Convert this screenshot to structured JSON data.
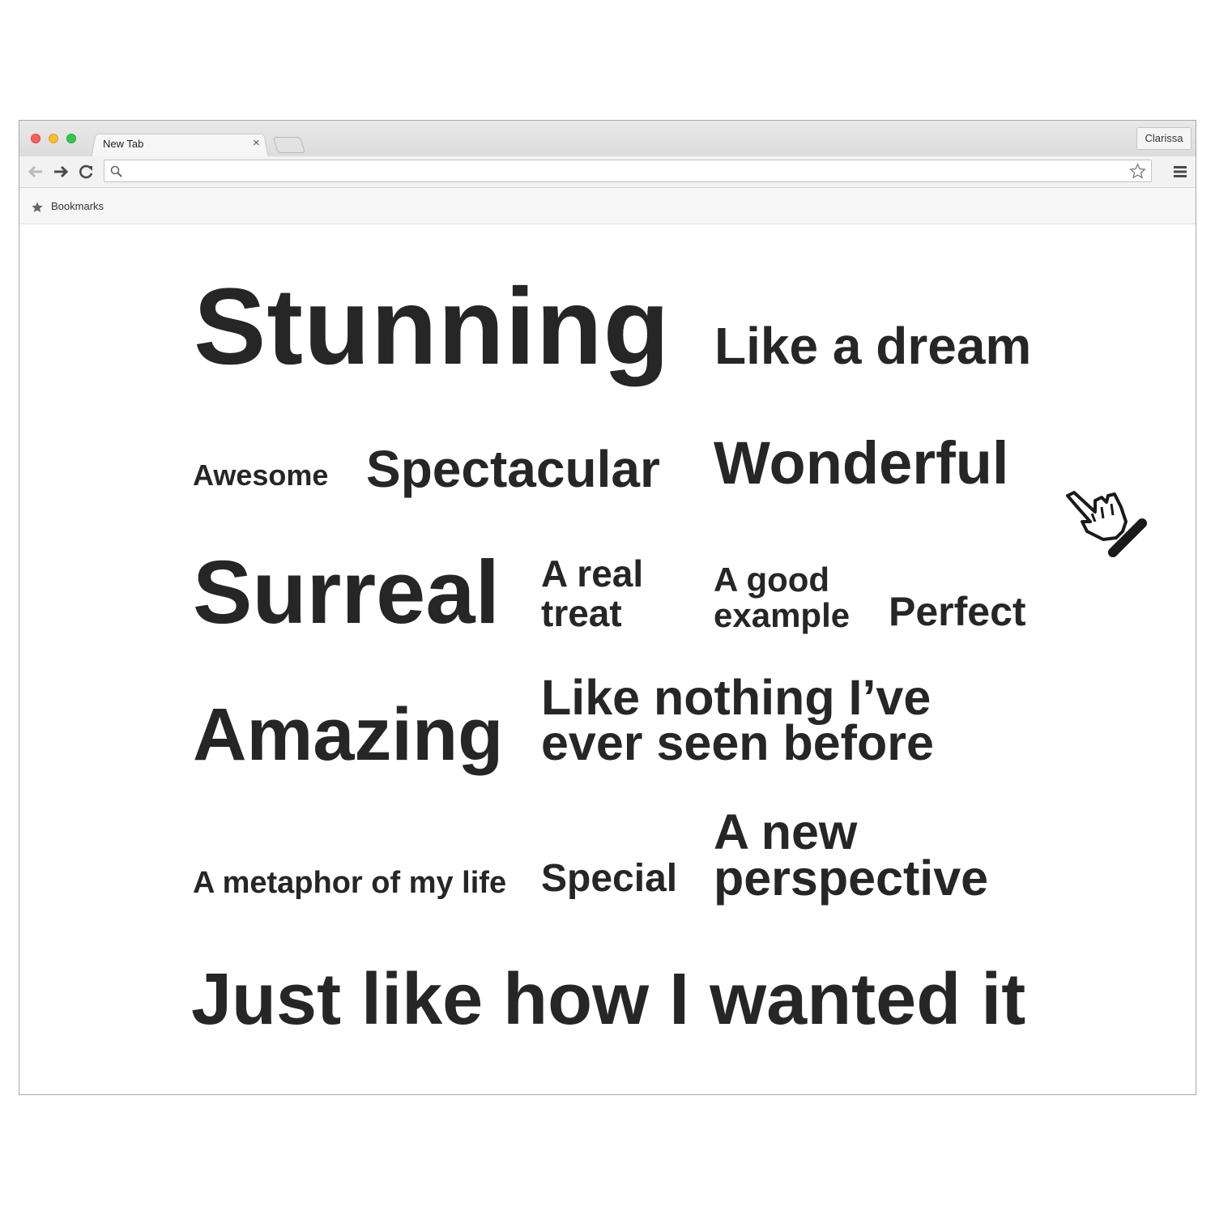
{
  "browser": {
    "tab_title": "New Tab",
    "tab_close": "×",
    "profile_name": "Clarissa",
    "omnibox_value": "",
    "bookmarks_label": "Bookmarks"
  },
  "page": {
    "words": {
      "stunning": "Stunning",
      "like_a_dream": "Like a dream",
      "awesome": "Awesome",
      "spectacular": "Spectacular",
      "wonderful": "Wonderful",
      "surreal": "Surreal",
      "a_real_treat_1": "A real",
      "a_real_treat_2": "treat",
      "a_good_example_1": "A good",
      "a_good_example_2": "example",
      "perfect": "Perfect",
      "amazing": "Amazing",
      "like_nothing_1": "Like nothing I’ve",
      "like_nothing_2": "ever seen before",
      "metaphor": "A metaphor of my life",
      "special": "Special",
      "new_perspective_1": "A new",
      "new_perspective_2": "perspective",
      "just_like": "Just like how I wanted it"
    }
  },
  "colors": {
    "text": "#262626",
    "light_red": "#fc5f57",
    "light_yellow": "#fdbc2e",
    "light_green": "#34c84a"
  },
  "icons": {
    "cursor": "hand-pointer-icon",
    "back": "arrow-left-icon",
    "forward": "arrow-right-icon",
    "reload": "reload-icon",
    "search": "search-icon",
    "star": "star-outline-icon",
    "menu": "hamburger-menu-icon",
    "bookmark": "star-icon"
  }
}
